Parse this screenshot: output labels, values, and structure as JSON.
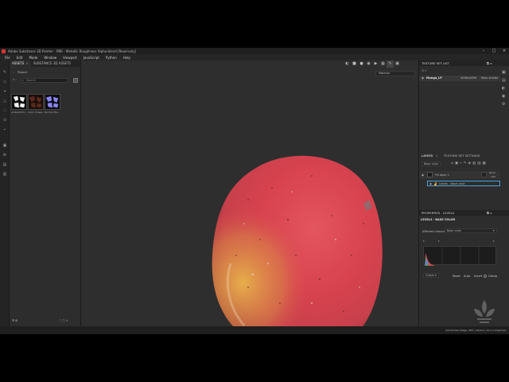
{
  "window": {
    "title": "Adobe Substance 3D Painter - PBR - Metallic Roughness Alpha-blend [Read-only]"
  },
  "menu": [
    "File",
    "Edit",
    "Mode",
    "Window",
    "Viewport",
    "JavaScript",
    "Python",
    "Help"
  ],
  "assets_panel": {
    "tabs": [
      "ASSETS",
      "SUBSTANCE 3D ASSETS"
    ],
    "breadcrumb": "Project",
    "search_placeholder": "Search",
    "items": [
      {
        "label": "ambientOcc..."
      },
      {
        "label": "Color Image..."
      },
      {
        "label": "Normal Ma..."
      }
    ]
  },
  "viewport": {
    "material_select": "Material"
  },
  "texture_set_list": {
    "title": "TEXTURE SET LIST",
    "set_name": "Mango_LP",
    "resolution": "4096x4096",
    "shader": "Main shader"
  },
  "layers_panel": {
    "tabs": [
      "LAYERS",
      "TEXTURE SET SETTINGS"
    ],
    "channel_select": "Base color",
    "layers": [
      {
        "name": "Fill layer 1",
        "blend": "Norm",
        "opacity": "100"
      }
    ],
    "effect": "Levels - Base color"
  },
  "properties_panel": {
    "title": "PROPERTIES - LEVELS",
    "subtitle": "LEVELS - BASE COLOR",
    "affected_label": "Affected channel",
    "affected_value": "Base color",
    "mode_select": "Colors",
    "buttons": {
      "reset": "Reset",
      "auto": "Auto",
      "invert": "Invert",
      "clamp": "Clamp"
    }
  },
  "statusbar": {
    "text": "Cache Disk Usage:  36% | Version: 10.1.2 (OpenGL)"
  },
  "colors": {
    "accent": "#4aa3df",
    "mango_red": "#d8434f",
    "mango_yellow": "#e0b14a"
  }
}
